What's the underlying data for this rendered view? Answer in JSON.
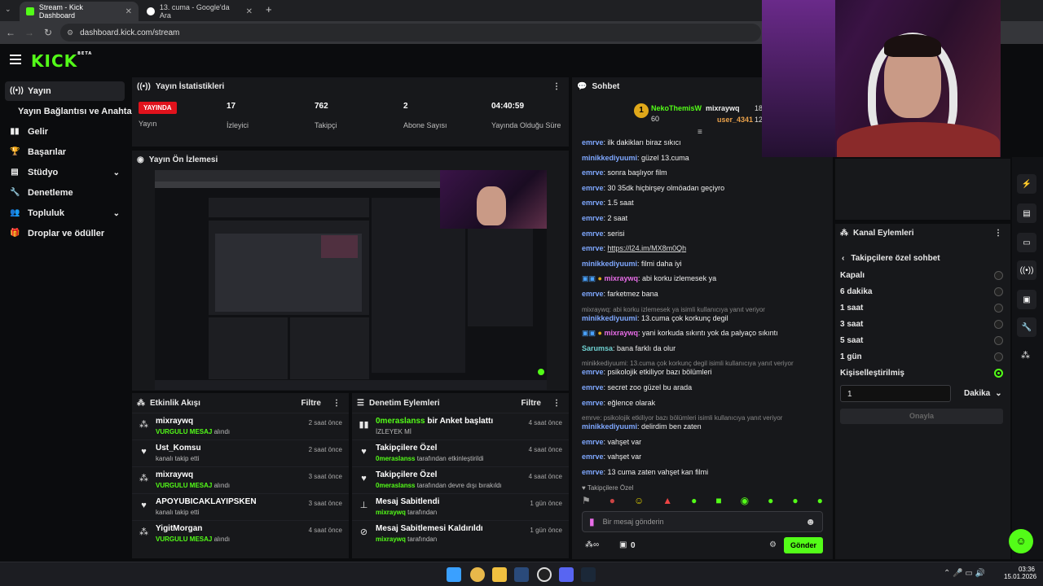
{
  "browser": {
    "tabs": [
      {
        "title": "Stream - Kick Dashboard"
      },
      {
        "title": "13. cuma - Google'da Ara"
      }
    ],
    "url": "dashboard.kick.com/stream"
  },
  "header": {
    "logo": "KICK",
    "logo_tag": "BETA"
  },
  "sidebar": {
    "items": [
      {
        "label": "Yayın",
        "icon": "live-icon"
      },
      {
        "label": "Yayın Bağlantısı ve Anahtarı",
        "icon": ""
      },
      {
        "label": "Gelir",
        "icon": "chart-icon"
      },
      {
        "label": "Başarılar",
        "icon": "trophy-icon"
      },
      {
        "label": "Stüdyo",
        "icon": "studio-icon"
      },
      {
        "label": "Denetleme",
        "icon": "wrench-icon"
      },
      {
        "label": "Topluluk",
        "icon": "people-icon"
      },
      {
        "label": "Droplar ve ödüller",
        "icon": "gift-icon"
      }
    ]
  },
  "stats": {
    "title": "Yayın İstatistikleri",
    "live_badge": "YAYINDA",
    "live_label": "Yayın",
    "viewers": {
      "value": "17",
      "label": "İzleyici"
    },
    "followers": {
      "value": "762",
      "label": "Takipçi"
    },
    "subs": {
      "value": "2",
      "label": "Abone Sayısı"
    },
    "uptime": {
      "value": "04:40:59",
      "label": "Yayında Olduğu Süre"
    }
  },
  "preview": {
    "title": "Yayın Ön İzlemesi"
  },
  "activity": {
    "title": "Etkinlik Akışı",
    "filter": "Filtre",
    "rows": [
      {
        "title": "mixraywq",
        "highlight": "VURGULU MESAJ",
        "sub": "alındı",
        "time": "2 saat önce",
        "icon": "users-icon"
      },
      {
        "title": "Ust_Komsu",
        "highlight": "",
        "sub": "kanalı takip etti",
        "time": "2 saat önce",
        "icon": "heart-icon"
      },
      {
        "title": "mixraywq",
        "highlight": "VURGULU MESAJ",
        "sub": "alındı",
        "time": "3 saat önce",
        "icon": "users-icon"
      },
      {
        "title": "APOYUBICAKLAYIPSKEN",
        "highlight": "",
        "sub": "kanalı takip etti",
        "time": "3 saat önce",
        "icon": "heart-icon"
      },
      {
        "title": "YigitMorgan",
        "highlight": "VURGULU MESAJ",
        "sub": "alındı",
        "time": "4 saat önce",
        "icon": "users-icon"
      }
    ]
  },
  "moderation": {
    "title": "Denetim Eylemleri",
    "filter": "Filtre",
    "rows": [
      {
        "title_green": "0meraslanss",
        "title": "bir Anket başlattı",
        "sub_green": "",
        "sub": "İZLEYEK Mİ",
        "time": "4 saat önce",
        "icon": "poll-icon"
      },
      {
        "title_green": "",
        "title": "Takipçilere Özel",
        "sub_green": "0meraslanss",
        "sub": "tarafından etkinleştirildi",
        "time": "4 saat önce",
        "icon": "heart-icon"
      },
      {
        "title_green": "",
        "title": "Takipçilere Özel",
        "sub_green": "0meraslanss",
        "sub": "tarafından devre dışı bırakıldı",
        "time": "4 saat önce",
        "icon": "heart-icon"
      },
      {
        "title_green": "",
        "title": "Mesaj Sabitlendi",
        "sub_green": "mixraywq",
        "sub": "tarafından",
        "time": "1 gün önce",
        "icon": "pin-icon"
      },
      {
        "title_green": "",
        "title": "Mesaj Sabitlemesi Kaldırıldı",
        "sub_green": "mixraywq",
        "sub": "tarafından",
        "time": "1 gün önce",
        "icon": "unpin-icon"
      }
    ]
  },
  "chat": {
    "title": "Sohbet",
    "top": [
      {
        "rank": "1",
        "name": "NekoThemisW",
        "value": "60"
      },
      {
        "name": "mixraywq",
        "value": "18"
      },
      {
        "name": "user_4341",
        "value": "12"
      }
    ],
    "messages": [
      {
        "user": "emrve",
        "color": "#7fa8ff",
        "text": "ilk dakikları biraz sıkıcı"
      },
      {
        "user": "minikkediyuumi",
        "color": "#7fa8ff",
        "text": "güzel 13.cuma"
      },
      {
        "user": "emrve",
        "color": "#7fa8ff",
        "text": "sonra başlıyor film"
      },
      {
        "user": "emrve",
        "color": "#7fa8ff",
        "text": "30 35dk hiçbirşey olmöadan geçiyro"
      },
      {
        "user": "emrve",
        "color": "#7fa8ff",
        "text": "1.5 saat"
      },
      {
        "user": "emrve",
        "color": "#7fa8ff",
        "text": "2 saat"
      },
      {
        "user": "emrve",
        "color": "#7fa8ff",
        "text": "serisi"
      },
      {
        "user": "emrve",
        "color": "#7fa8ff",
        "text": "https://l24.im/MX8m0Qh"
      },
      {
        "user": "minikkediyuumi",
        "color": "#7fa8ff",
        "text": "filmi daha iyi"
      },
      {
        "user": "mixraywq",
        "color": "#e86de8",
        "text": "abi korku izlemesek ya"
      },
      {
        "user": "emrve",
        "color": "#7fa8ff",
        "text": "farketmez bana"
      },
      {
        "reply": "mixraywq: abi korku izlemesek ya isimli kullanıcıya yanıt veriyor"
      },
      {
        "user": "minikkediyuumi",
        "color": "#7fa8ff",
        "text": "13.cuma çok korkunç degil"
      },
      {
        "user": "mixraywq",
        "color": "#e86de8",
        "text": "yani korkuda sıkıntı yok da palyaço sıkıntı"
      },
      {
        "user": "Sarumsa",
        "color": "#6fd1d1",
        "text": "bana farklı da olur"
      },
      {
        "reply": "minikkediyuumi: 13.cuma çok korkunç degil isimli kullanıcıya yanıt veriyor"
      },
      {
        "user": "emrve",
        "color": "#7fa8ff",
        "text": "psikolojik etkiliyor bazı bölümleri"
      },
      {
        "user": "emrve",
        "color": "#7fa8ff",
        "text": "secret zoo güzel bu arada"
      },
      {
        "user": "emrve",
        "color": "#7fa8ff",
        "text": "eğlence olarak"
      },
      {
        "reply": "emrve: psikolojik etkiliyor bazı bölümleri isimli kullanıcıya yanıt veriyor"
      },
      {
        "user": "minikkediyuumi",
        "color": "#7fa8ff",
        "text": "delirdim ben zaten"
      },
      {
        "user": "emrve",
        "color": "#7fa8ff",
        "text": "vahşet var"
      },
      {
        "user": "emrve",
        "color": "#7fa8ff",
        "text": "vahşet var"
      },
      {
        "user": "emrve",
        "color": "#7fa8ff",
        "text": "13 cuma zaten vahşet kan filmi"
      }
    ],
    "followers_only": "Takipçilere Özel",
    "placeholder": "Bir mesaj gönderin",
    "points": "0",
    "send": "Gönder"
  },
  "channel_actions": {
    "title": "Kanal Eylemleri",
    "back_title": "Takipçilere özel sohbet",
    "options": [
      {
        "label": "Kapalı",
        "on": false
      },
      {
        "label": "6 dakika",
        "on": false
      },
      {
        "label": "1 saat",
        "on": false
      },
      {
        "label": "3 saat",
        "on": false
      },
      {
        "label": "5 saat",
        "on": false
      },
      {
        "label": "1 gün",
        "on": false
      },
      {
        "label": "Kişiselleştirilmiş",
        "on": true
      }
    ],
    "custom_value": "1",
    "unit": "Dakika",
    "confirm": "Onayla"
  },
  "taskbar": {
    "time": "03:36",
    "date": "15.01.2026"
  },
  "colors": {
    "accent": "#53fc18",
    "live": "#e0121c",
    "panel": "#17181b",
    "bg": "#0b0c0e"
  }
}
